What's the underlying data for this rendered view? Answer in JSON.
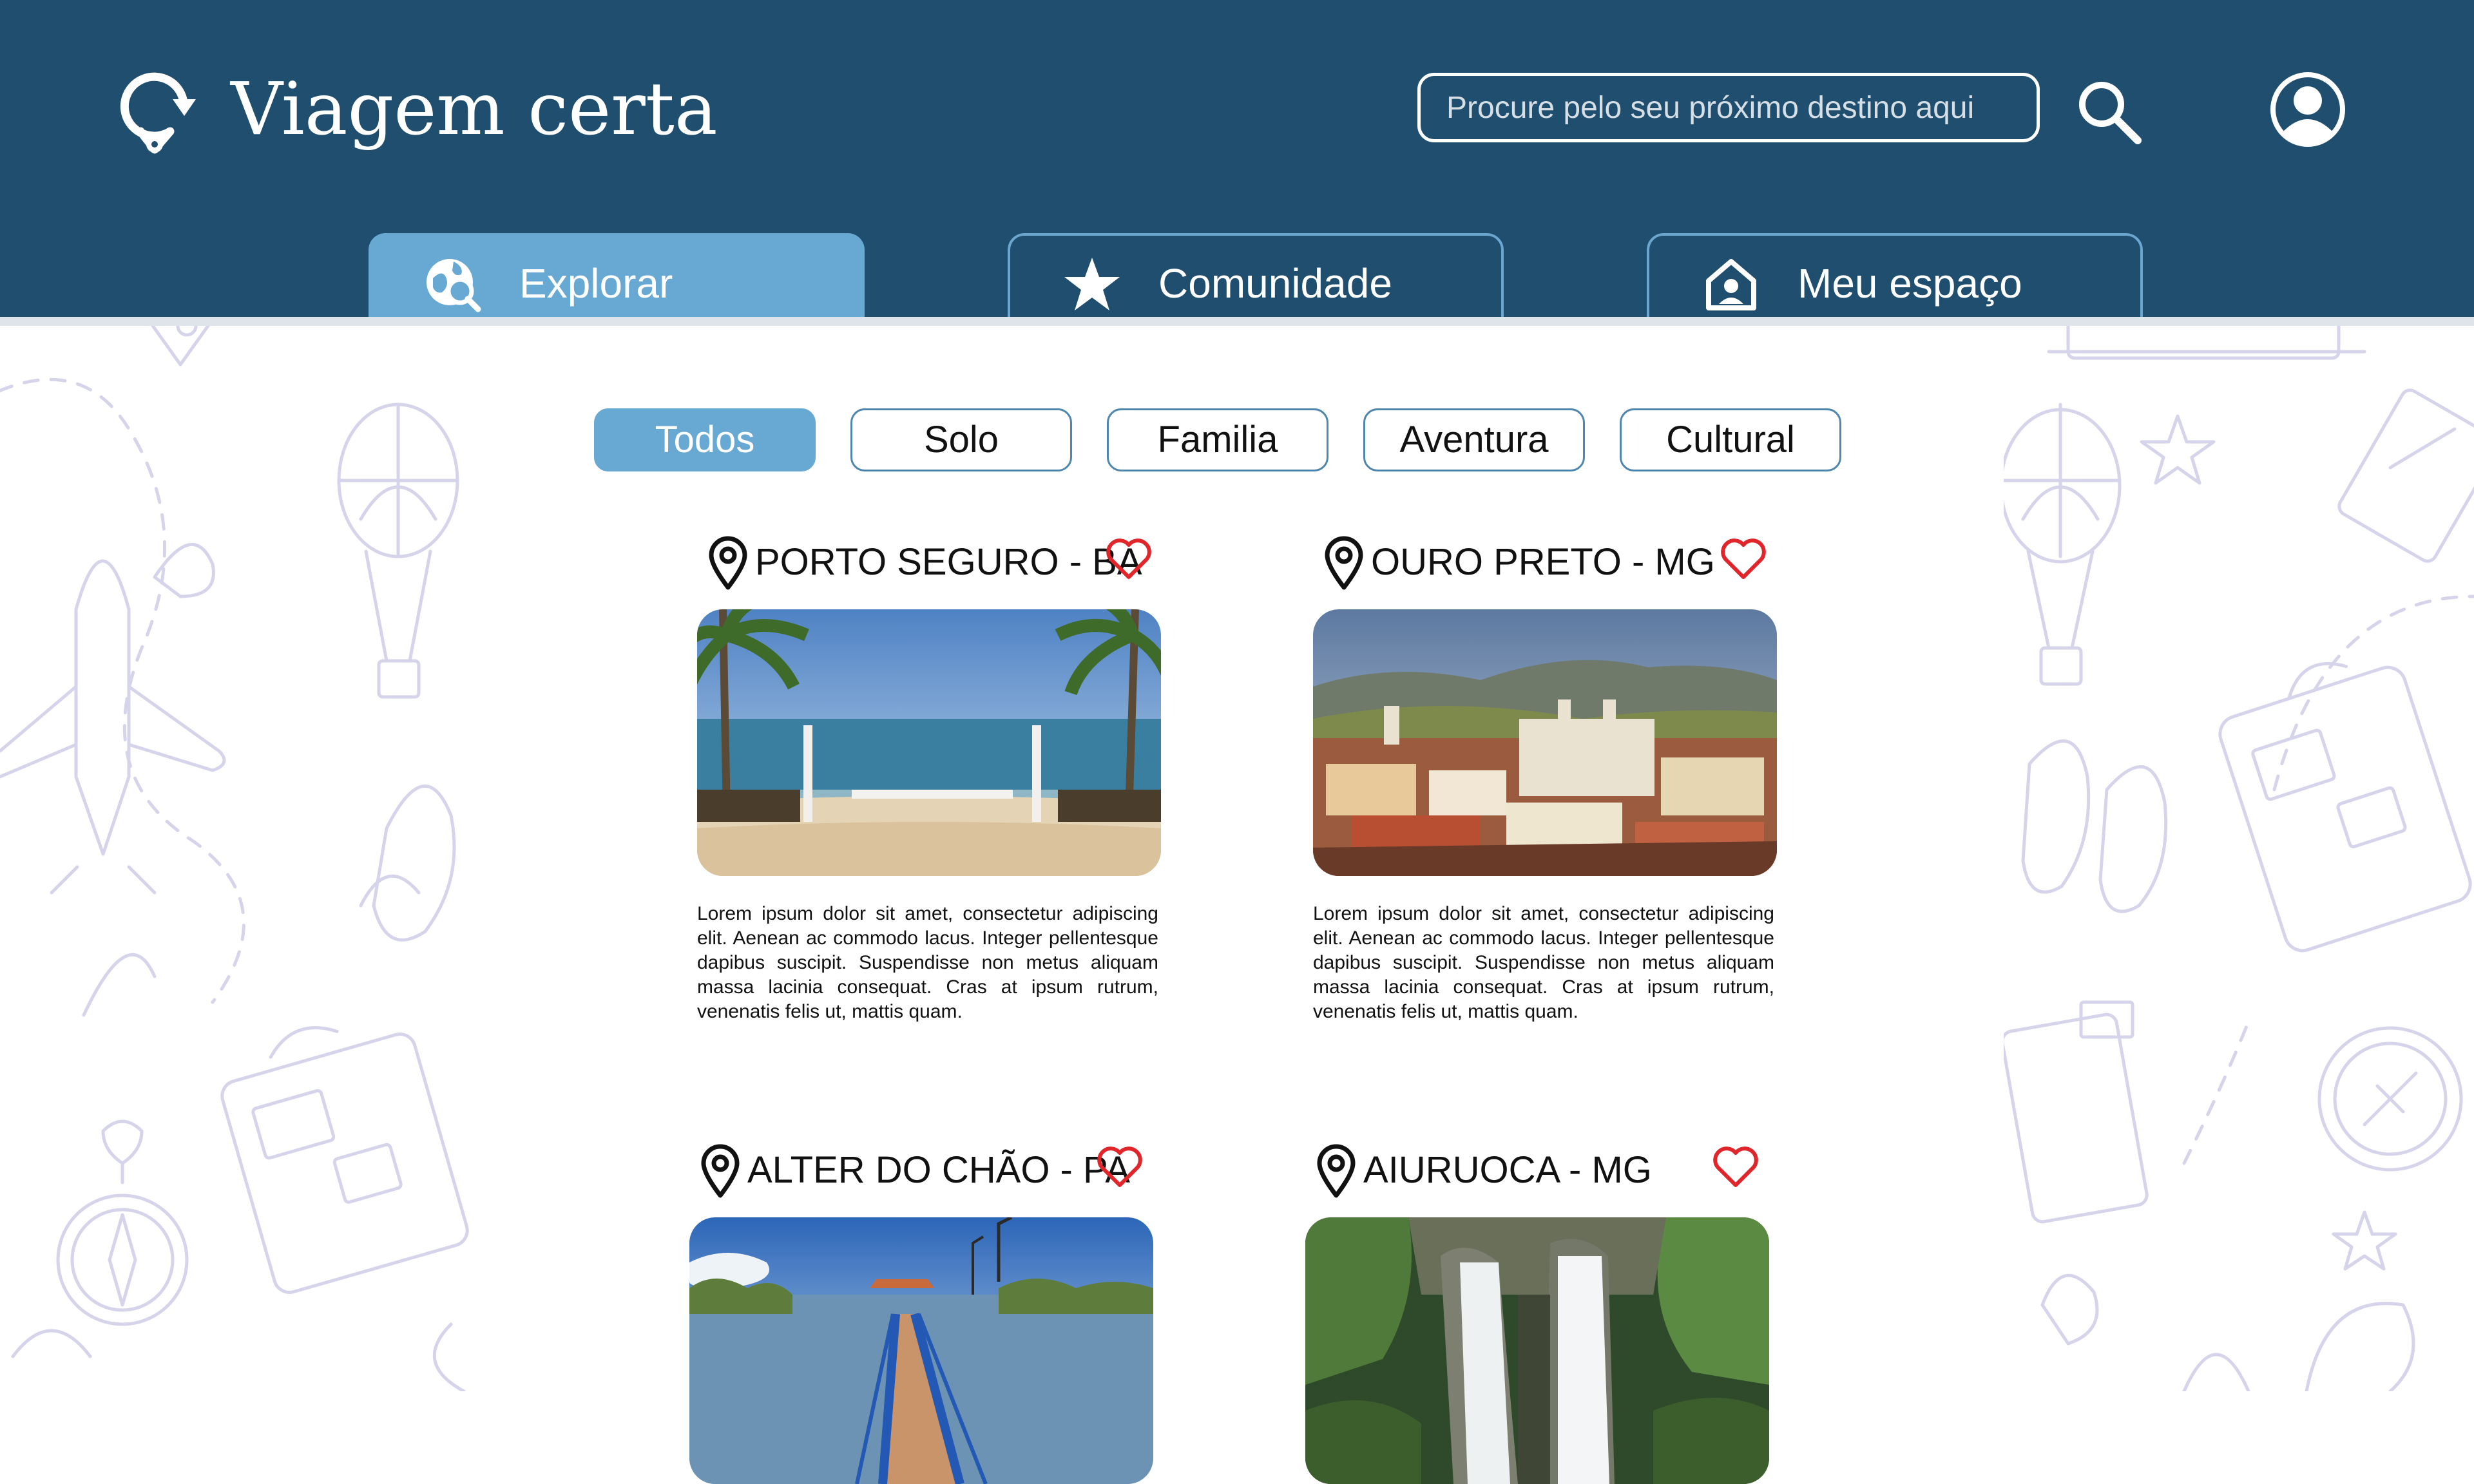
{
  "app": {
    "title": "Viagem certa",
    "logo_icon": "location-refresh-icon"
  },
  "header": {
    "search_placeholder": "Procure pelo seu próximo destino aqui",
    "search_icon": "search-icon",
    "profile_icon": "user-circle-icon"
  },
  "nav": {
    "tabs": [
      {
        "label": "Explorar",
        "icon": "globe-search-icon",
        "active": true
      },
      {
        "label": "Comunidade",
        "icon": "star-icon",
        "active": false
      },
      {
        "label": "Meu espaço",
        "icon": "home-user-icon",
        "active": false
      }
    ]
  },
  "filters": [
    {
      "label": "Todos",
      "active": true
    },
    {
      "label": "Solo",
      "active": false
    },
    {
      "label": "Familia",
      "active": false
    },
    {
      "label": "Aventura",
      "active": false
    },
    {
      "label": "Cultural",
      "active": false
    }
  ],
  "destinations": [
    {
      "name": "PORTO SEGURO - BA",
      "description": "Lorem ipsum dolor sit amet, consectetur adipiscing elit. Aenean ac commodo lacus. Integer pellentesque dapibus suscipit. Suspendisse non metus aliquam massa lacinia consequat. Cras at ipsum rutrum, venenatis felis ut, mattis quam.",
      "image": "beach-with-palm-trees"
    },
    {
      "name": "OURO PRETO - MG",
      "description": "Lorem ipsum dolor sit amet, consectetur adipiscing elit. Aenean ac commodo lacus. Integer pellentesque dapibus suscipit. Suspendisse non metus aliquam massa lacinia consequat. Cras at ipsum rutrum, venenatis felis ut, mattis quam.",
      "image": "colonial-town-with-mountains"
    },
    {
      "name": "ALTER DO CHÃO - PA",
      "description": "",
      "image": "wooden-pier-over-river"
    },
    {
      "name": "AIURUOCA - MG",
      "description": "",
      "image": "waterfall-in-forest"
    }
  ],
  "colors": {
    "header": "#1f4e6e",
    "accent": "#68a9d4",
    "pill_border": "#4f86ad",
    "heart": "#e0252b",
    "deco_lines": "#d6d4ea"
  }
}
